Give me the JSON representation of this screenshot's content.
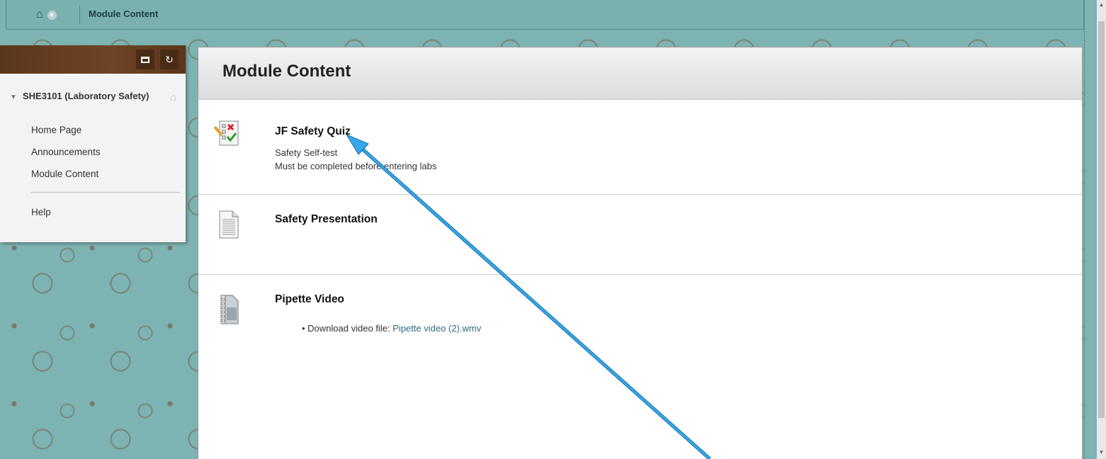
{
  "breadcrumb": {
    "title": "Module Content"
  },
  "menu": {
    "course_title": "SHE3101 (Laboratory Safety)",
    "items": [
      "Home Page",
      "Announcements",
      "Module Content"
    ],
    "help": "Help"
  },
  "page": {
    "title": "Module Content"
  },
  "content_items": [
    {
      "title": "JF Safety Quiz",
      "desc1": "Safety Self-test",
      "desc2": "Must be completed before entering labs",
      "icon": "test-icon"
    },
    {
      "title": "Safety Presentation",
      "icon": "document-icon"
    },
    {
      "title": "Pipette Video",
      "download_label": "Download video file: ",
      "download_link": "Pipette video (2).wmv",
      "icon": "video-file-icon"
    }
  ],
  "colors": {
    "accent_arrow": "#2a9ee0",
    "menu_header": "#5a361b",
    "background": "#7db3b2"
  }
}
